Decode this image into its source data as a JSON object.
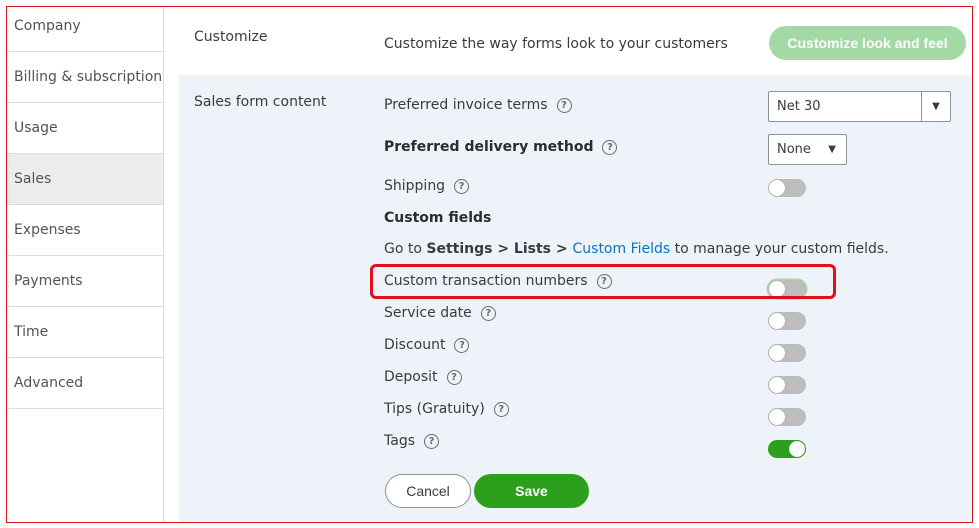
{
  "sidebar": {
    "items": [
      {
        "label": "Company"
      },
      {
        "label": "Billing & subscription"
      },
      {
        "label": "Usage"
      },
      {
        "label": "Sales"
      },
      {
        "label": "Expenses"
      },
      {
        "label": "Payments"
      },
      {
        "label": "Time"
      },
      {
        "label": "Advanced"
      }
    ]
  },
  "customize": {
    "section_label": "Customize",
    "description": "Customize the way forms look to your customers",
    "button_label": "Customize look and feel"
  },
  "sales_form": {
    "section_label": "Sales form content",
    "invoice_terms": {
      "label": "Preferred invoice terms",
      "value": "Net 30"
    },
    "delivery_method": {
      "label": "Preferred delivery method",
      "value": "None"
    },
    "shipping": {
      "label": "Shipping",
      "on": false
    },
    "custom_fields": {
      "heading": "Custom fields",
      "goto_text": "Go to ",
      "path": "Settings > Lists > ",
      "link": "Custom Fields",
      "suffix": " to manage your custom fields."
    },
    "custom_txn_numbers": {
      "label": "Custom transaction numbers",
      "on": false
    },
    "service_date": {
      "label": "Service date",
      "on": false
    },
    "discount": {
      "label": "Discount",
      "on": false
    },
    "deposit": {
      "label": "Deposit",
      "on": false
    },
    "tips": {
      "label": "Tips (Gratuity)",
      "on": false
    },
    "tags": {
      "label": "Tags",
      "on": true
    }
  },
  "actions": {
    "cancel_label": "Cancel",
    "save_label": "Save"
  },
  "colors": {
    "accent_green": "#2ca01c",
    "disabled_green": "#a3d9a5",
    "link_blue": "#0077c5",
    "highlight_red": "#e0101a"
  },
  "icons": {
    "help": "question-circle-icon",
    "caret": "caret-down-icon"
  }
}
